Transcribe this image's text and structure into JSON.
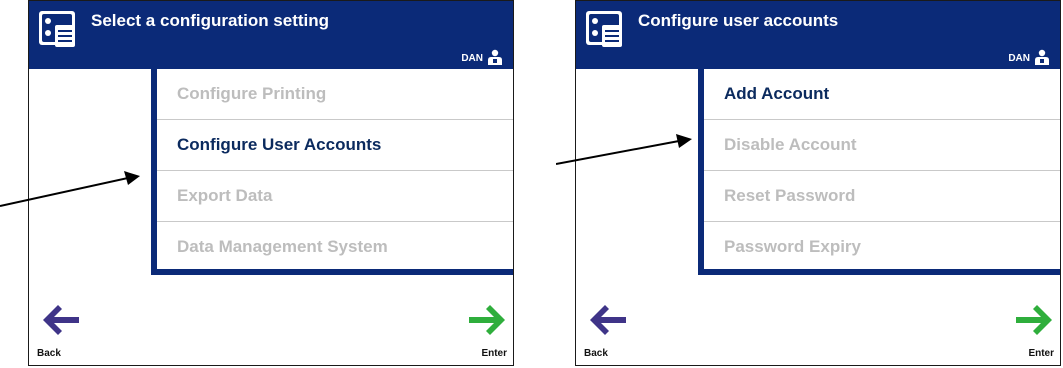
{
  "colors": {
    "header_bg": "#0b2a78",
    "selected_text": "#0b2a5e",
    "disabled_text": "#c3c3c3",
    "back_arrow": "#3f3488",
    "enter_arrow": "#2fae3c"
  },
  "left_screen": {
    "title": "Select a configuration setting",
    "user": "DAN",
    "menu": [
      {
        "label": "Configure Printing",
        "state": "dim"
      },
      {
        "label": "Configure User Accounts",
        "state": "selected"
      },
      {
        "label": "Export Data",
        "state": "dim"
      },
      {
        "label": "Data Management System",
        "state": "dim"
      }
    ],
    "back_label": "Back",
    "enter_label": "Enter"
  },
  "right_screen": {
    "title": "Configure user accounts",
    "user": "DAN",
    "menu": [
      {
        "label": "Add Account",
        "state": "selected"
      },
      {
        "label": "Disable Account",
        "state": "dim"
      },
      {
        "label": "Reset Password",
        "state": "dim"
      },
      {
        "label": "Password Expiry",
        "state": "dim"
      }
    ],
    "back_label": "Back",
    "enter_label": "Enter"
  },
  "icons": {
    "header": "settings-list-icon",
    "user": "user-icon",
    "back": "back-arrow-icon",
    "enter": "enter-arrow-icon",
    "pointer": "pointer-arrow-icon"
  }
}
